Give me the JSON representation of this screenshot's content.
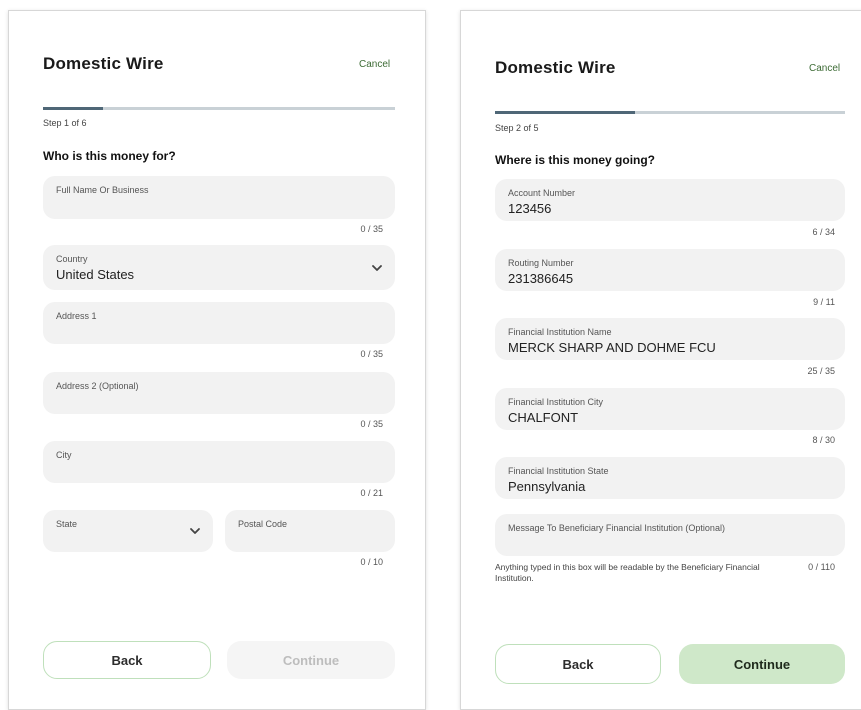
{
  "left": {
    "title": "Domestic Wire",
    "cancel": "Cancel",
    "progress": 0.17,
    "step": "Step 1 of 6",
    "question": "Who is this money for?",
    "fields": {
      "full_name": {
        "label": "Full Name Or Business",
        "value": "",
        "counter": "0 / 35"
      },
      "country": {
        "label": "Country",
        "value": "United States"
      },
      "address1": {
        "label": "Address 1",
        "value": "",
        "counter": "0 / 35"
      },
      "address2": {
        "label": "Address 2 (Optional)",
        "value": "",
        "counter": "0 / 35"
      },
      "city": {
        "label": "City",
        "value": "",
        "counter": "0 / 21"
      },
      "state": {
        "label": "State",
        "value": ""
      },
      "postal": {
        "label": "Postal Code",
        "value": "",
        "counter": "0 / 10"
      }
    },
    "back": "Back",
    "continue": "Continue"
  },
  "right": {
    "title": "Domestic Wire",
    "cancel": "Cancel",
    "progress": 0.4,
    "step": "Step 2 of 5",
    "question": "Where is this money going?",
    "fields": {
      "account": {
        "label": "Account Number",
        "value": "123456",
        "counter": "6 / 34"
      },
      "routing": {
        "label": "Routing Number",
        "value": "231386645",
        "counter": "9 / 11"
      },
      "fi_name": {
        "label": "Financial Institution Name",
        "value": "MERCK SHARP AND DOHME FCU",
        "counter": "25 / 35"
      },
      "fi_city": {
        "label": "Financial Institution City",
        "value": "CHALFONT",
        "counter": "8 / 30"
      },
      "fi_state": {
        "label": "Financial Institution State",
        "value": "Pennsylvania"
      },
      "message": {
        "label": "Message To Beneficiary Financial Institution (Optional)",
        "value": "",
        "counter": "0 / 110",
        "hint": "Anything typed in this box will be readable by the Beneficiary Financial Institution."
      }
    },
    "back": "Back",
    "continue": "Continue"
  },
  "colors": {
    "accent_green": "#cfe8c9",
    "progress_fill": "#4f6777",
    "field_bg": "#f2f2f2"
  },
  "icons": {
    "dropdown": "chevron-down-icon"
  }
}
